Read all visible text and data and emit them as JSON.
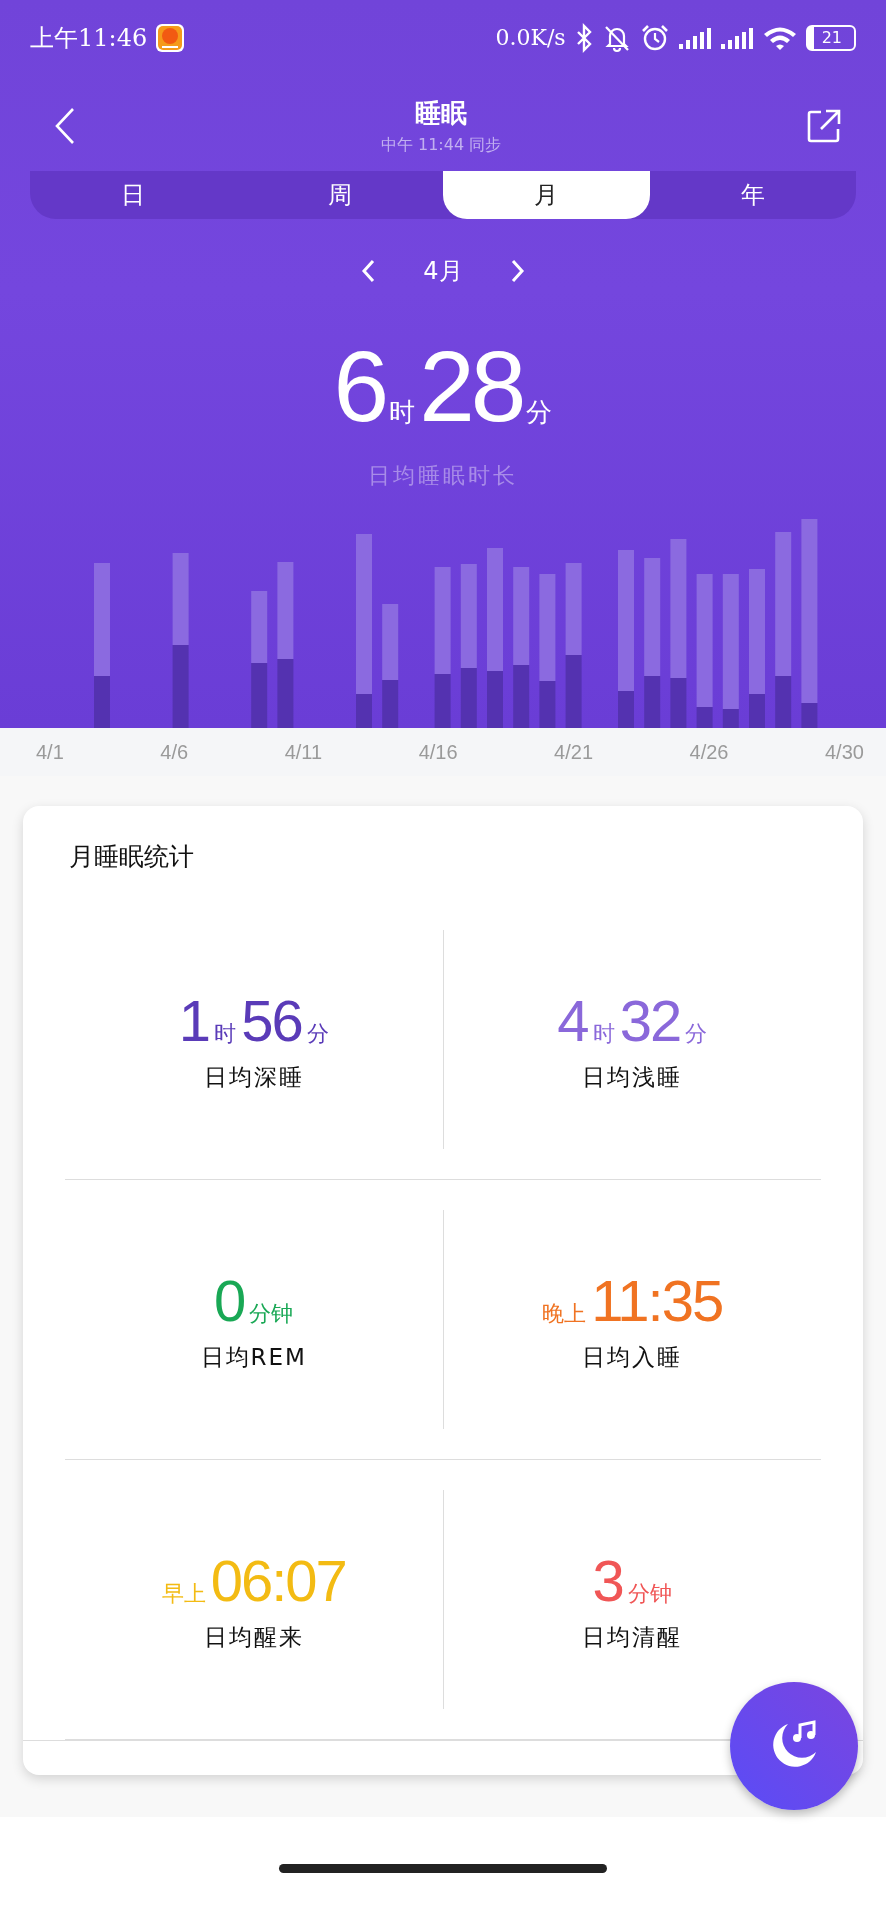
{
  "status_bar": {
    "time": "上午11:46",
    "network_speed": "0.0K/s",
    "battery": "21"
  },
  "header": {
    "title": "睡眠",
    "subtitle": "中午 11:44 同步"
  },
  "tabs": [
    {
      "label": "日",
      "selected": false
    },
    {
      "label": "周",
      "selected": false
    },
    {
      "label": "月",
      "selected": true
    },
    {
      "label": "年",
      "selected": false
    }
  ],
  "period": {
    "label": "4月"
  },
  "summary": {
    "parts": [
      {
        "kind": "number",
        "text": "6"
      },
      {
        "kind": "unit",
        "text": "时"
      },
      {
        "kind": "number",
        "text": "28"
      },
      {
        "kind": "unit",
        "text": "分"
      }
    ],
    "caption": "日均睡眠时长"
  },
  "chart": {
    "x_labels": [
      "4/1",
      "4/6",
      "4/11",
      "4/16",
      "4/21",
      "4/26",
      "4/30"
    ]
  },
  "stats": {
    "title": "月睡眠统计",
    "items": [
      {
        "color": "#5a3bb8",
        "parts": [
          {
            "kind": "number",
            "text": "1"
          },
          {
            "kind": "unit",
            "text": "时"
          },
          {
            "kind": "number",
            "text": "56"
          },
          {
            "kind": "unit",
            "text": "分"
          }
        ],
        "label": "日均深睡"
      },
      {
        "color": "#8a68da",
        "parts": [
          {
            "kind": "number",
            "text": "4"
          },
          {
            "kind": "unit",
            "text": "时"
          },
          {
            "kind": "number",
            "text": "32"
          },
          {
            "kind": "unit",
            "text": "分"
          }
        ],
        "label": "日均浅睡"
      },
      {
        "color": "#19a855",
        "parts": [
          {
            "kind": "number",
            "text": "0"
          },
          {
            "kind": "unit",
            "text": "分钟"
          }
        ],
        "label": "日均REM"
      },
      {
        "color": "#f07322",
        "parts": [
          {
            "kind": "unit",
            "text": "晚上"
          },
          {
            "kind": "number",
            "text": "11:35"
          }
        ],
        "label": "日均入睡"
      },
      {
        "color": "#f3bb13",
        "parts": [
          {
            "kind": "unit",
            "text": "早上"
          },
          {
            "kind": "number",
            "text": "06:07"
          }
        ],
        "label": "日均醒来"
      },
      {
        "color": "#f05656",
        "parts": [
          {
            "kind": "number",
            "text": "3"
          },
          {
            "kind": "unit",
            "text": "分钟"
          }
        ],
        "label": "日均清醒"
      }
    ]
  }
}
